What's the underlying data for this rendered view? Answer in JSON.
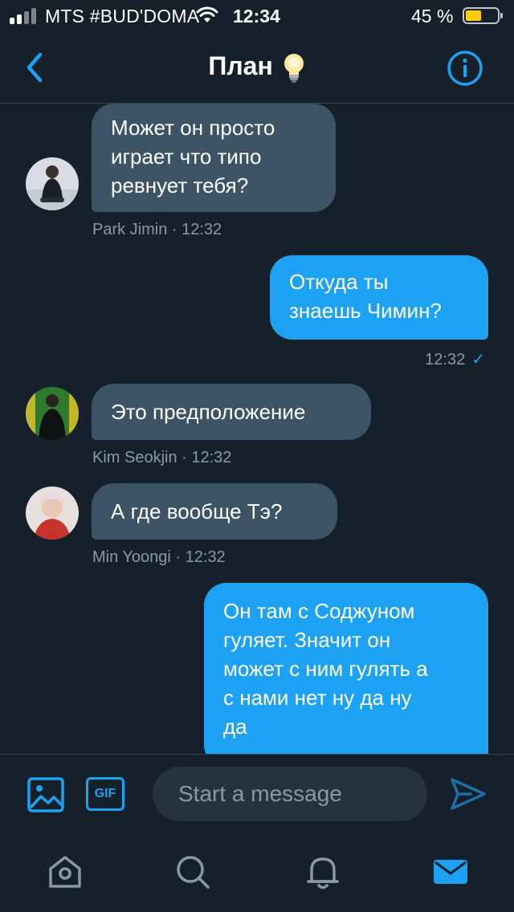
{
  "status_bar": {
    "carrier": "MTS #BUD'DOMA",
    "time": "12:34",
    "battery_percent": "45 %"
  },
  "header": {
    "title": "План",
    "back_icon": "chevron-left-icon",
    "info_icon": "info-icon",
    "title_emoji_icon": "lightbulb-icon"
  },
  "messages": [
    {
      "direction": "in",
      "text": "Может он просто\nиграет что типо\nревнует тебя?",
      "sender": "Park Jimin",
      "time": "12:32",
      "meta": "Park Jimin · 12:32"
    },
    {
      "direction": "out",
      "text": "Откуда ты\nзнаешь Чимин?",
      "time": "12:32",
      "read": true
    },
    {
      "direction": "in",
      "text": "Это предположение",
      "sender": "Kim Seokjin",
      "time": "12:32",
      "meta": "Kim Seokjin · 12:32"
    },
    {
      "direction": "in",
      "text": "А где вообще Тэ?",
      "sender": "Min Yoongi",
      "time": "12:32",
      "meta": "Min Yoongi · 12:32"
    },
    {
      "direction": "out",
      "text": "Он там с Соджуном\nгуляет. Значит он\nможет с ним гулять а\nс нами нет ну да ну\nда"
    }
  ],
  "composer": {
    "placeholder": "Start a message",
    "gif_label": "GIF"
  },
  "tabbar": [
    "home-icon",
    "search-icon",
    "notifications-icon",
    "messages-icon"
  ],
  "colors": {
    "background": "#15202b",
    "incoming_bubble": "#3d5466",
    "outgoing_bubble": "#1da1f2",
    "accent": "#1da1f2",
    "meta_text": "#8899a6"
  }
}
